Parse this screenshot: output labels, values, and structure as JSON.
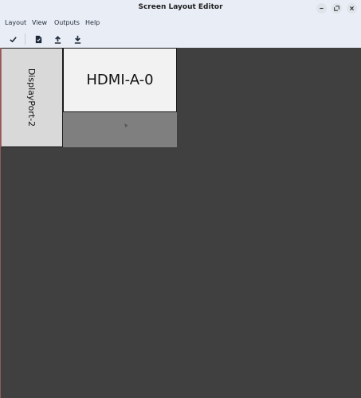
{
  "window": {
    "title": "Screen Layout Editor"
  },
  "menu": {
    "layout": "Layout",
    "view": "View",
    "outputs": "Outputs",
    "help": "Help"
  },
  "toolbar": {
    "apply_icon": "check-icon",
    "save_icon": "save-file-icon",
    "upload_icon": "upload-icon",
    "download_icon": "download-icon"
  },
  "outputs": [
    {
      "name": "DisplayPort-2",
      "orientation": "rotated",
      "primary": false
    },
    {
      "name": "HDMI-A-0",
      "orientation": "normal",
      "primary": false
    }
  ],
  "colors": {
    "canvas_bg": "#404040",
    "header_bg": "#e9edf5",
    "output_dp_bg": "#d9d9d9",
    "output_hdmi_bg": "#f2f2f2",
    "shadow": "#7f7f7f"
  }
}
